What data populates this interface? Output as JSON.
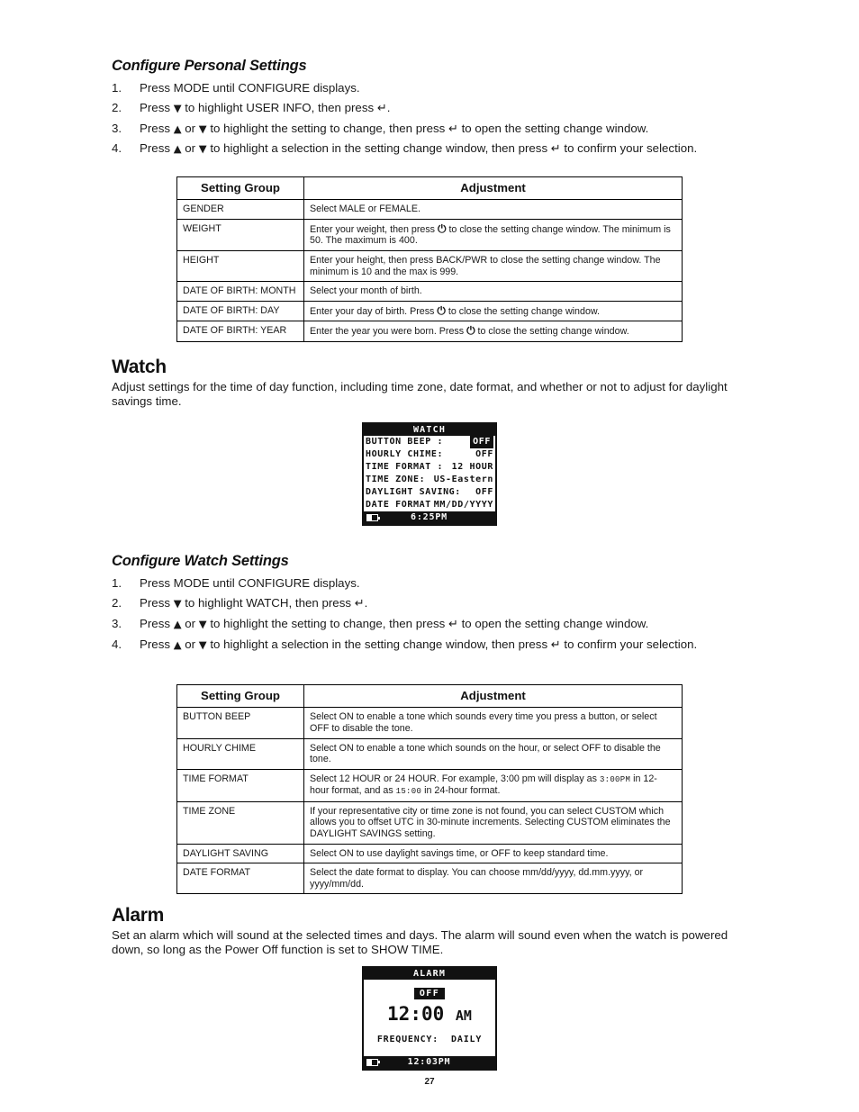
{
  "page": {
    "number": "27"
  },
  "glyphs": {
    "down_arrow": "▼",
    "up_arrow": "▲",
    "return": "↵",
    "power": "⏻"
  },
  "personal": {
    "heading": "Configure Personal Settings",
    "steps": [
      {
        "num": "1.",
        "pre": "Press MODE until CONFIGURE displays.",
        "post": ""
      },
      {
        "num": "2.",
        "pre": "Press ",
        "g1": "▼",
        "mid": " to highlight USER INFO, then press ",
        "g2": "↵",
        "post": "."
      },
      {
        "num": "3.",
        "pre": "Press ",
        "g1": "▲",
        "mid1": " or ",
        "g2": "▼",
        "mid": " to highlight the setting to change, then press ",
        "g3": "↵",
        "post": " to open the setting change window."
      },
      {
        "num": "4.",
        "pre": "Press ",
        "g1": "▲",
        "mid1": " or ",
        "g2": "▼",
        "mid": " to highlight a selection in the setting change window, then press ",
        "g3": "↵",
        "post": " to confirm your selection."
      }
    ],
    "table": {
      "headers": [
        "Setting Group",
        "Adjustment"
      ],
      "rows": [
        {
          "group": "GENDER",
          "adjustment": "Select MALE or FEMALE."
        },
        {
          "group": "WEIGHT",
          "adj_pre": "Enter your weight, then press ",
          "adj_glyph": "⏻",
          "adj_post": " to close the setting change window. The minimum is 50. The maximum is 400."
        },
        {
          "group": "HEIGHT",
          "adjustment": "Enter your height, then press BACK/PWR to close the setting change window. The minimum is 10 and the max is 999."
        },
        {
          "group": "DATE OF BIRTH: MONTH",
          "adjustment": "Select your month of birth."
        },
        {
          "group": "DATE OF BIRTH: DAY",
          "adj_pre": "Enter your day of birth. Press ",
          "adj_glyph": "⏻",
          "adj_post": " to close the setting change window."
        },
        {
          "group": "DATE OF BIRTH: YEAR",
          "adj_pre": "Enter the year you were born. Press ",
          "adj_glyph": "⏻",
          "adj_post": " to close the setting change window."
        }
      ]
    }
  },
  "watch": {
    "heading": "Watch",
    "intro": "Adjust settings for the time of day function, including time zone, date format, and whether or not to adjust for daylight savings time.",
    "lcd": {
      "title": "WATCH",
      "rows": [
        {
          "label": "BUTTON BEEP :",
          "value": "OFF",
          "highlighted": true
        },
        {
          "label": "HOURLY CHIME:",
          "value": "OFF",
          "highlighted": false
        },
        {
          "label": "TIME FORMAT :",
          "value": "12 HOUR",
          "highlighted": false
        },
        {
          "label": "TIME ZONE:",
          "value": "US-Eastern",
          "highlighted": false
        },
        {
          "label": "DAYLIGHT SAVING:",
          "value": "OFF",
          "highlighted": false
        },
        {
          "label": "DATE FORMAT",
          "value": "MM/DD/YYYY",
          "highlighted": false
        }
      ],
      "status_time": "6:25PM",
      "battery_icon": "battery-icon"
    },
    "config_heading": "Configure Watch Settings",
    "steps": [
      {
        "num": "1.",
        "pre": "Press MODE until CONFIGURE displays.",
        "post": ""
      },
      {
        "num": "2.",
        "pre": "Press ",
        "g1": "▼",
        "mid": " to highlight WATCH, then press ",
        "g2": "↵",
        "post": "."
      },
      {
        "num": "3.",
        "pre": "Press ",
        "g1": "▲",
        "mid1": " or ",
        "g2": "▼",
        "mid": " to highlight the setting to change, then press ",
        "g3": "↵",
        "post": " to open the setting change window."
      },
      {
        "num": "4.",
        "pre": "Press ",
        "g1": "▲",
        "mid1": " or ",
        "g2": "▼",
        "mid": " to highlight a selection in the setting change window, then press ",
        "g3": "↵",
        "post": " to confirm your selection."
      }
    ],
    "table": {
      "headers": [
        "Setting Group",
        "Adjustment"
      ],
      "rows": [
        {
          "group": "BUTTON BEEP",
          "adjustment": "Select ON to enable a tone which sounds every time you press a button, or select OFF to disable the tone."
        },
        {
          "group": "HOURLY CHIME",
          "adjustment": "Select ON to enable a tone which sounds on the hour, or select OFF to disable the tone."
        },
        {
          "group": "TIME FORMAT",
          "adj_pre": "Select 12 HOUR or 24 HOUR. For example, 3:00 pm will display as ",
          "adj_mono1": "3:00PM",
          "adj_mid": " in 12-hour format, and as ",
          "adj_mono2": "15:00",
          "adj_post": " in 24-hour format."
        },
        {
          "group": "TIME ZONE",
          "adjustment": "If your representative city or time zone is not found, you can select CUSTOM which allows you to offset UTC in 30-minute increments. Selecting CUSTOM eliminates the DAYLIGHT SAVINGS setting."
        },
        {
          "group": "DAYLIGHT SAVING",
          "adjustment": "Select ON to use daylight savings time, or OFF to keep standard time."
        },
        {
          "group": "DATE FORMAT",
          "adjustment": "Select the date format to display. You can choose mm/dd/yyyy, dd.mm.yyyy, or yyyy/mm/dd."
        }
      ]
    }
  },
  "alarm": {
    "heading": "Alarm",
    "intro": "Set an alarm which will sound at the selected times and days. The alarm will sound even when the watch is powered down, so long as the Power Off function is set to SHOW TIME.",
    "lcd": {
      "title": "ALARM",
      "state": "OFF",
      "time": "12:00",
      "ampm": "AM",
      "frequency_label": "FREQUENCY:",
      "frequency_value": "DAILY",
      "status_time": "12:03PM",
      "battery_icon": "battery-icon"
    }
  }
}
